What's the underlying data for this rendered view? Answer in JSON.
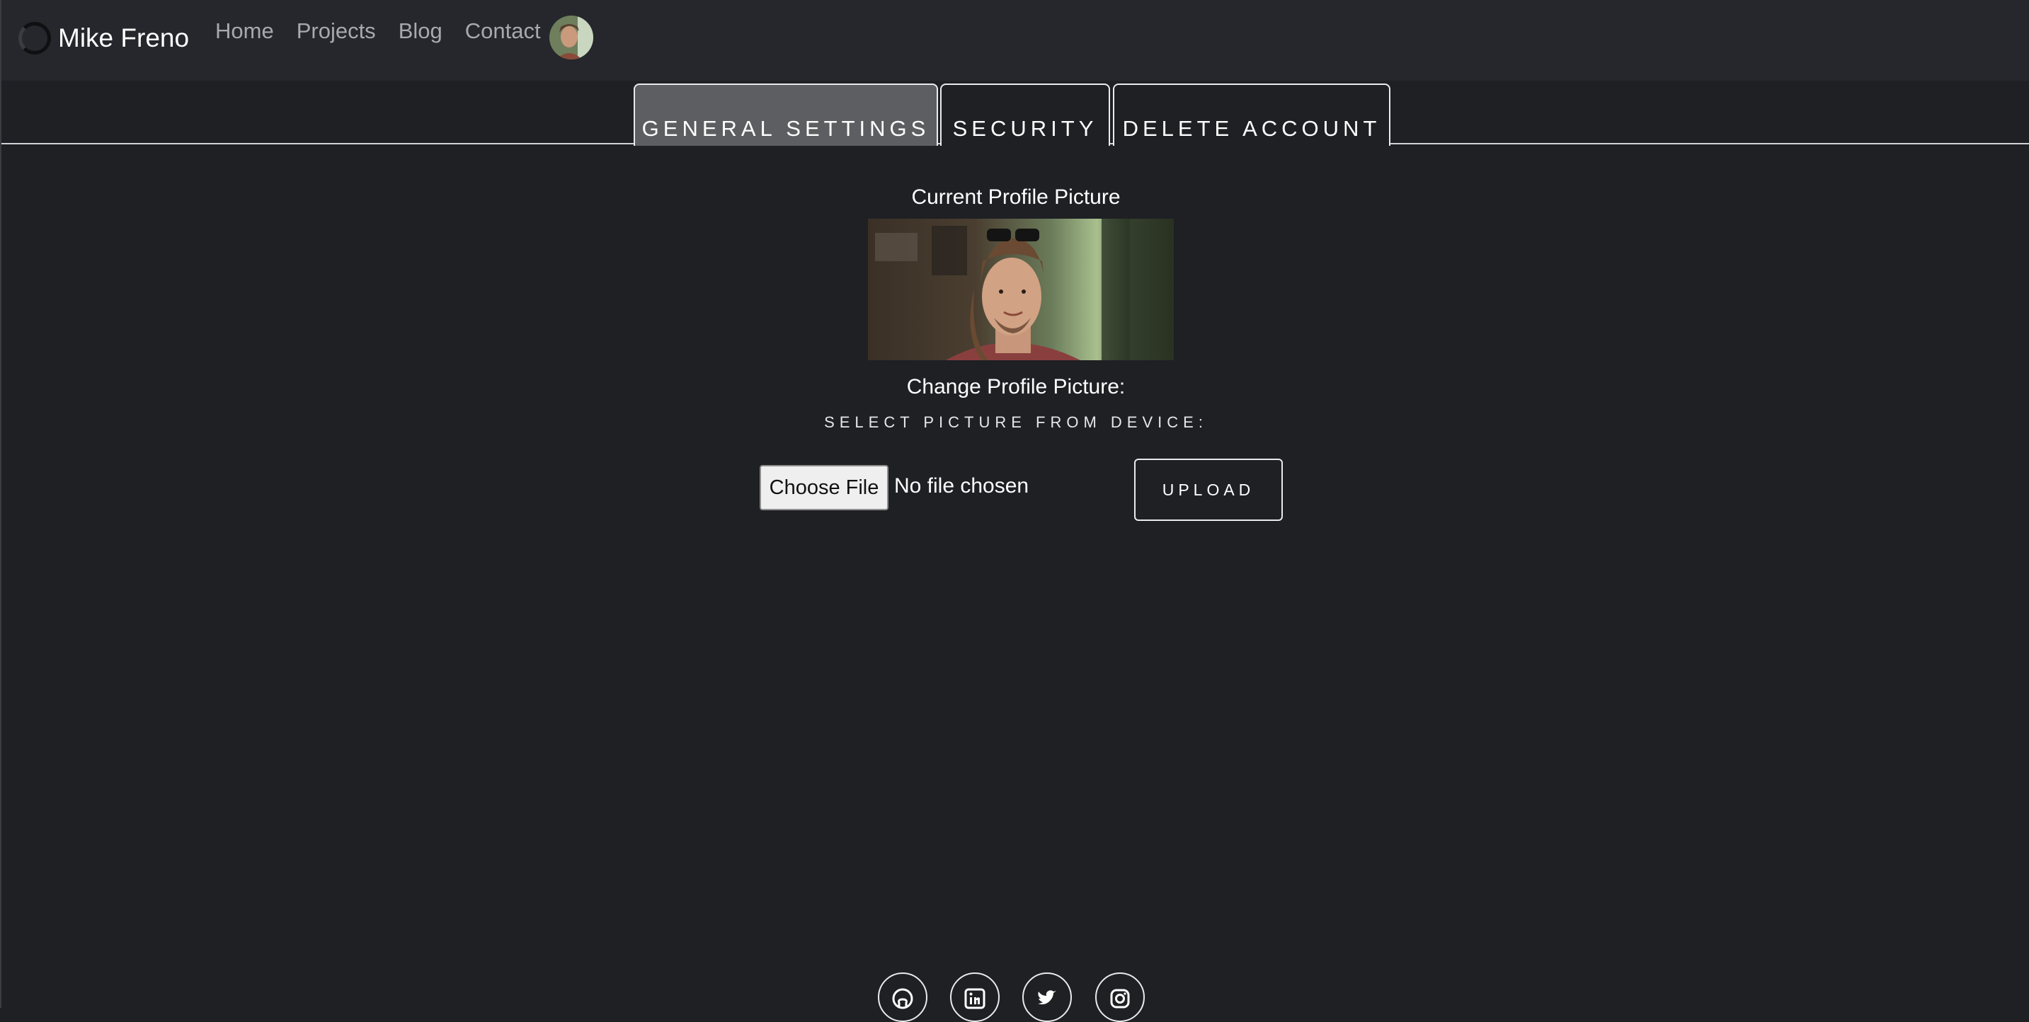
{
  "navbar": {
    "brand": "Mike Freno",
    "links": [
      "Home",
      "Projects",
      "Blog",
      "Contact"
    ]
  },
  "tabs": [
    {
      "label": "GENERAL SETTINGS",
      "active": true
    },
    {
      "label": "SECURITY",
      "active": false
    },
    {
      "label": "DELETE ACCOUNT",
      "active": false
    }
  ],
  "main": {
    "current_label": "Current Profile Picture",
    "change_label": "Change Profile Picture:",
    "select_label": "SELECT PICTURE FROM DEVICE:",
    "choose_file_label": "Choose File",
    "no_file_text": "No file chosen",
    "upload_label": "UPLOAD"
  },
  "footer": {
    "social_icons": [
      "github-icon",
      "linkedin-icon",
      "twitter-icon",
      "instagram-icon"
    ]
  },
  "colors": {
    "background": "#1e2024",
    "navbar": "#25272c",
    "active_tab": "#5d5e61",
    "nav_link": "#a6a9ae"
  }
}
